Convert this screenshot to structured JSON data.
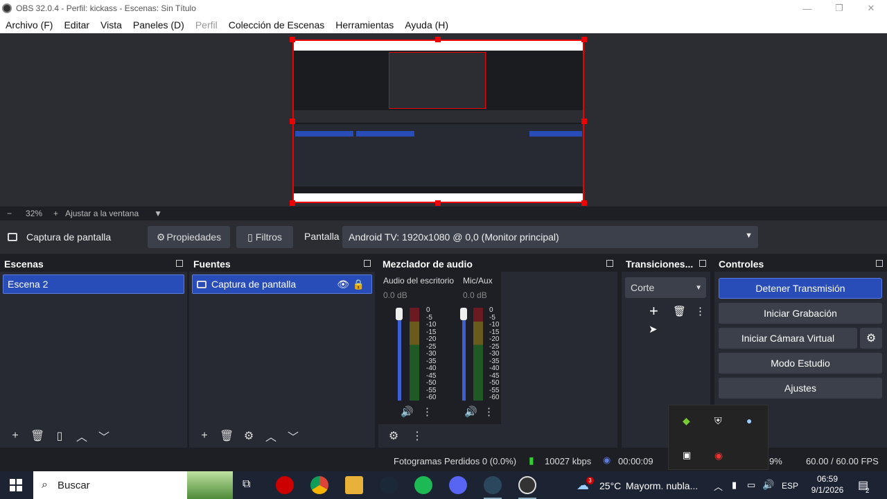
{
  "window": {
    "title": "OBS 32.0.4 - Perfil: kickass - Escenas: Sin Título"
  },
  "menu": [
    "Archivo (F)",
    "Editar",
    "Vista",
    "Paneles (D)",
    "Perfil",
    "Colección de Escenas",
    "Herramientas",
    "Ayuda (H)"
  ],
  "zoom": {
    "minus": "−",
    "value": "32%",
    "plus": "+",
    "fit_label": "Ajustar a la ventana"
  },
  "source_toolbar": {
    "source_name": "Captura de pantalla",
    "properties_label": "Propiedades",
    "filters_label": "Filtros",
    "display_label": "Pantalla",
    "display_value": "Android TV: 1920x1080 @ 0,0 (Monitor principal)"
  },
  "scenes": {
    "title": "Escenas",
    "items": [
      "Escena 2"
    ]
  },
  "sources": {
    "title": "Fuentes",
    "items": [
      "Captura de pantalla"
    ]
  },
  "mixer": {
    "title": "Mezclador de audio",
    "channels": [
      {
        "name": "Audio del escritorio",
        "level": "0.0 dB"
      },
      {
        "name": "Mic/Aux",
        "level": "0.0 dB"
      }
    ],
    "scale": [
      "0",
      "-5",
      "-10",
      "-15",
      "-20",
      "-25",
      "-30",
      "-35",
      "-40",
      "-45",
      "-50",
      "-55",
      "-60"
    ]
  },
  "transitions": {
    "title": "Transiciones...",
    "selected": "Corte"
  },
  "controls": {
    "title": "Controles",
    "buttons": [
      "Detener Transmisión",
      "Iniciar Grabación",
      "Iniciar Cámara Virtual",
      "Modo Estudio",
      "Ajustes"
    ]
  },
  "status": {
    "dropped_frames": "Fotogramas Perdidos 0 (0.0%)",
    "bitrate": "10027 kbps",
    "stream_time": "00:00:09",
    "cpu": "9%",
    "fps": "60.00 / 60.00 FPS"
  },
  "taskbar": {
    "search_placeholder": "Buscar",
    "weather_temp": "25°C",
    "weather_text": "Mayorm. nubla...",
    "weather_badge": "3",
    "lang": "ESP",
    "time": "06:59",
    "date": "9/1/2026",
    "notif_count": "2"
  },
  "colors": {
    "accent": "#284cb8",
    "capture_border": "#e00000"
  }
}
